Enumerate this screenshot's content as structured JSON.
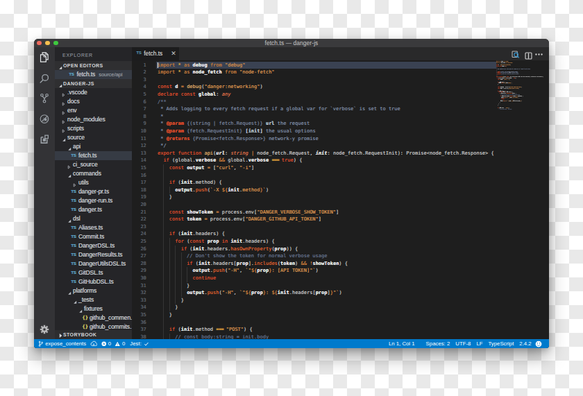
{
  "window": {
    "title": "fetch.ts — danger-js"
  },
  "activity_bar": {
    "icons": [
      "explorer-icon",
      "search-icon",
      "source-control-icon",
      "debug-icon",
      "extensions-icon"
    ],
    "settings_icon": "gear-icon"
  },
  "sidebar": {
    "explorer_title": "EXPLORER",
    "open_editors": {
      "label": "OPEN EDITORS",
      "items": [
        {
          "icon": "TS",
          "name": "fetch.ts",
          "detail": "source/api",
          "selected": true
        }
      ]
    },
    "project": {
      "label": "DANGER-JS",
      "tree": [
        {
          "name": ".vscode",
          "type": "folder",
          "level": 1,
          "expanded": false
        },
        {
          "name": "docs",
          "type": "folder",
          "level": 1,
          "expanded": false
        },
        {
          "name": "env",
          "type": "folder",
          "level": 1,
          "expanded": false
        },
        {
          "name": "node_modules",
          "type": "folder",
          "level": 1,
          "expanded": false
        },
        {
          "name": "scripts",
          "type": "folder",
          "level": 1,
          "expanded": false
        },
        {
          "name": "source",
          "type": "folder",
          "level": 1,
          "expanded": true
        },
        {
          "name": "api",
          "type": "folder",
          "level": 2,
          "expanded": true
        },
        {
          "name": "fetch.ts",
          "type": "ts",
          "level": 3,
          "selected": true
        },
        {
          "name": "ci_source",
          "type": "folder",
          "level": 2,
          "expanded": false
        },
        {
          "name": "commands",
          "type": "folder",
          "level": 2,
          "expanded": true
        },
        {
          "name": "utils",
          "type": "folder",
          "level": 3,
          "expanded": false
        },
        {
          "name": "danger-pr.ts",
          "type": "ts",
          "level": 3
        },
        {
          "name": "danger-run.ts",
          "type": "ts",
          "level": 3
        },
        {
          "name": "danger.ts",
          "type": "ts",
          "level": 3
        },
        {
          "name": "dsl",
          "type": "folder",
          "level": 2,
          "expanded": true
        },
        {
          "name": "Aliases.ts",
          "type": "ts",
          "level": 3
        },
        {
          "name": "Commit.ts",
          "type": "ts",
          "level": 3
        },
        {
          "name": "DangerDSL.ts",
          "type": "ts",
          "level": 3
        },
        {
          "name": "DangerResults.ts",
          "type": "ts",
          "level": 3
        },
        {
          "name": "DangerUtilsDSL.ts",
          "type": "ts",
          "level": 3
        },
        {
          "name": "GitDSL.ts",
          "type": "ts",
          "level": 3
        },
        {
          "name": "GitHubDSL.ts",
          "type": "ts",
          "level": 3
        },
        {
          "name": "platforms",
          "type": "folder",
          "level": 2,
          "expanded": true
        },
        {
          "name": "_tests",
          "type": "folder",
          "level": 3,
          "expanded": true
        },
        {
          "name": "fixtures",
          "type": "folder",
          "level": 4,
          "expanded": true
        },
        {
          "name": "github_commen..",
          "type": "json",
          "level": 5
        },
        {
          "name": "github_commits..",
          "type": "json",
          "level": 5
        }
      ]
    },
    "storybook": {
      "label": "STORYBOOK"
    }
  },
  "editor": {
    "tab": {
      "icon": "TS",
      "label": "fetch.ts",
      "close": "✕"
    },
    "actions": [
      "open-changes-icon",
      "split-editor-icon",
      "more-actions-icon"
    ],
    "lines": [
      {
        "n": 1,
        "tokens": [
          [
            "ik",
            "import "
          ],
          [
            "st",
            "* "
          ],
          [
            "ik",
            "as "
          ],
          [
            "v",
            "debug "
          ],
          [
            "ik",
            "from "
          ],
          [
            "s",
            "\"debug\""
          ]
        ]
      },
      {
        "n": 2,
        "tokens": [
          [
            "ik",
            "import "
          ],
          [
            "st",
            "* "
          ],
          [
            "ik",
            "as "
          ],
          [
            "v",
            "node_fetch "
          ],
          [
            "ik",
            "from "
          ],
          [
            "s",
            "\"node-fetch\""
          ]
        ]
      },
      {
        "n": 3,
        "tokens": []
      },
      {
        "n": 4,
        "tokens": [
          [
            "k",
            "const "
          ],
          [
            "v",
            "d "
          ],
          [
            "op",
            "= "
          ],
          [
            "fd",
            "debug"
          ],
          [
            "p",
            "("
          ],
          [
            "s",
            "\"danger:networking\""
          ],
          [
            "p",
            ")"
          ]
        ]
      },
      {
        "n": 5,
        "tokens": [
          [
            "k",
            "declare "
          ],
          [
            "k",
            "const "
          ],
          [
            "v",
            "global"
          ],
          [
            "p",
            ": "
          ],
          [
            "ty",
            "any"
          ]
        ]
      },
      {
        "n": 6,
        "tokens": [
          [
            "c",
            "/**"
          ]
        ]
      },
      {
        "n": 7,
        "tokens": [
          [
            "dc",
            " * Adds logging to every fetch request if a global var for `verbose` is set to true"
          ]
        ]
      },
      {
        "n": 8,
        "tokens": [
          [
            "dc",
            " *"
          ]
        ]
      },
      {
        "n": 9,
        "tokens": [
          [
            "dc",
            " * "
          ],
          [
            "dt",
            "@param "
          ],
          [
            "db",
            "{(string | fetch.Request)} "
          ],
          [
            "dn",
            "url "
          ],
          [
            "dc",
            "the request"
          ]
        ]
      },
      {
        "n": 10,
        "tokens": [
          [
            "dc",
            " * "
          ],
          [
            "dt",
            "@param "
          ],
          [
            "db",
            "{fetch.RequestInit} "
          ],
          [
            "dn",
            "[init] "
          ],
          [
            "dc",
            "the usual options"
          ]
        ]
      },
      {
        "n": 11,
        "tokens": [
          [
            "dc",
            " * "
          ],
          [
            "dt",
            "@returns "
          ],
          [
            "db",
            "{Promise<fetch.Response>} "
          ],
          [
            "dc",
            "network-y promise"
          ]
        ]
      },
      {
        "n": 12,
        "tokens": [
          [
            "dc",
            " */"
          ]
        ]
      },
      {
        "n": 13,
        "tokens": [
          [
            "k",
            "export "
          ],
          [
            "k",
            "function "
          ],
          [
            "fd",
            "api"
          ],
          [
            "p",
            "("
          ],
          [
            "pi",
            "url"
          ],
          [
            "p",
            ": "
          ],
          [
            "ty",
            "string "
          ],
          [
            "op",
            "| "
          ],
          [
            "p",
            "node_fetch.Request, "
          ],
          [
            "pi",
            "init"
          ],
          [
            "p",
            ": "
          ],
          [
            "p",
            "node_fetch.RequestInit): Promise<node_fetch.Response> {"
          ]
        ]
      },
      {
        "n": 14,
        "tokens": [
          [
            "p",
            "  "
          ],
          [
            "k",
            "if "
          ],
          [
            "p",
            "(global."
          ],
          [
            "v",
            "verbose "
          ],
          [
            "op",
            "&& "
          ],
          [
            "p",
            "global."
          ],
          [
            "v",
            "verbose "
          ],
          [
            "opb",
            "=== "
          ],
          [
            "k",
            "true"
          ],
          [
            "p",
            ") {"
          ]
        ]
      },
      {
        "n": 15,
        "tokens": [
          [
            "p",
            "    "
          ],
          [
            "k",
            "const "
          ],
          [
            "v",
            "output "
          ],
          [
            "op",
            "= "
          ],
          [
            "p",
            "["
          ],
          [
            "s",
            "\"curl\""
          ],
          [
            "p",
            ", "
          ],
          [
            "s",
            "\"-i\""
          ],
          [
            "p",
            "]"
          ]
        ]
      },
      {
        "n": 16,
        "tokens": []
      },
      {
        "n": 17,
        "tokens": [
          [
            "p",
            "    "
          ],
          [
            "k",
            "if "
          ],
          [
            "p",
            "("
          ],
          [
            "v",
            "init"
          ],
          [
            "p",
            ".method) {"
          ]
        ]
      },
      {
        "n": 18,
        "tokens": [
          [
            "p",
            "      "
          ],
          [
            "v",
            "output"
          ],
          [
            "p",
            "."
          ],
          [
            "fn",
            "push"
          ],
          [
            "p",
            "("
          ],
          [
            "s",
            "`-X "
          ],
          [
            "op",
            "${"
          ],
          [
            "v",
            "init"
          ],
          [
            "p",
            "."
          ],
          [
            "s",
            "method"
          ],
          [
            "op",
            "}"
          ],
          [
            "s",
            "`"
          ],
          [
            "p",
            ")"
          ]
        ]
      },
      {
        "n": 19,
        "tokens": [
          [
            "p",
            "    }"
          ]
        ]
      },
      {
        "n": 20,
        "tokens": []
      },
      {
        "n": 21,
        "tokens": [
          [
            "p",
            "    "
          ],
          [
            "k",
            "const "
          ],
          [
            "v",
            "showToken "
          ],
          [
            "op",
            "= "
          ],
          [
            "p",
            "process.env["
          ],
          [
            "s",
            "\"DANGER_VERBOSE_SHOW_TOKEN\""
          ],
          [
            "p",
            "]"
          ]
        ]
      },
      {
        "n": 22,
        "tokens": [
          [
            "p",
            "    "
          ],
          [
            "k",
            "const "
          ],
          [
            "v",
            "token "
          ],
          [
            "op",
            "= "
          ],
          [
            "p",
            "process.env["
          ],
          [
            "s",
            "\"DANGER_GITHUB_API_TOKEN\""
          ],
          [
            "p",
            "]"
          ]
        ]
      },
      {
        "n": 23,
        "tokens": []
      },
      {
        "n": 24,
        "tokens": [
          [
            "p",
            "    "
          ],
          [
            "k",
            "if "
          ],
          [
            "p",
            "("
          ],
          [
            "v",
            "init"
          ],
          [
            "p",
            ".headers) {"
          ]
        ]
      },
      {
        "n": 25,
        "tokens": [
          [
            "p",
            "      "
          ],
          [
            "k",
            "for "
          ],
          [
            "p",
            "("
          ],
          [
            "k",
            "const "
          ],
          [
            "v",
            "prop "
          ],
          [
            "k",
            "in "
          ],
          [
            "v",
            "init"
          ],
          [
            "p",
            ".headers) {"
          ]
        ]
      },
      {
        "n": 26,
        "tokens": [
          [
            "p",
            "        "
          ],
          [
            "k",
            "if "
          ],
          [
            "p",
            "("
          ],
          [
            "v",
            "init"
          ],
          [
            "p",
            ".headers."
          ],
          [
            "fn",
            "hasOwnProperty"
          ],
          [
            "p",
            "("
          ],
          [
            "v",
            "prop"
          ],
          [
            "p",
            ")) {"
          ]
        ]
      },
      {
        "n": 27,
        "tokens": [
          [
            "c",
            "          // Don't show the token for normal verbose usage"
          ]
        ]
      },
      {
        "n": 28,
        "tokens": [
          [
            "p",
            "          "
          ],
          [
            "k",
            "if "
          ],
          [
            "p",
            "("
          ],
          [
            "v",
            "init"
          ],
          [
            "p",
            ".headers["
          ],
          [
            "v",
            "prop"
          ],
          [
            "p",
            "]."
          ],
          [
            "fn",
            "includes"
          ],
          [
            "p",
            "("
          ],
          [
            "v",
            "token"
          ],
          [
            "p",
            ") "
          ],
          [
            "op",
            "&& "
          ],
          [
            "op",
            "!"
          ],
          [
            "v",
            "showToken"
          ],
          [
            "p",
            ") {"
          ]
        ]
      },
      {
        "n": 29,
        "tokens": [
          [
            "p",
            "            "
          ],
          [
            "v",
            "output"
          ],
          [
            "p",
            "."
          ],
          [
            "fn",
            "push"
          ],
          [
            "p",
            "("
          ],
          [
            "s",
            "\"-H\""
          ],
          [
            "p",
            ", "
          ],
          [
            "s",
            "`\""
          ],
          [
            "op",
            "${"
          ],
          [
            "v",
            "prop"
          ],
          [
            "op",
            "}"
          ],
          [
            "s",
            ": [API TOKEN]\"`"
          ],
          [
            "p",
            ")"
          ]
        ]
      },
      {
        "n": 30,
        "tokens": [
          [
            "p",
            "            "
          ],
          [
            "k",
            "continue"
          ]
        ]
      },
      {
        "n": 31,
        "tokens": [
          [
            "p",
            "          }"
          ]
        ]
      },
      {
        "n": 32,
        "tokens": [
          [
            "p",
            "          "
          ],
          [
            "v",
            "output"
          ],
          [
            "p",
            "."
          ],
          [
            "fn",
            "push"
          ],
          [
            "p",
            "("
          ],
          [
            "s",
            "\"-H\""
          ],
          [
            "p",
            ", "
          ],
          [
            "s",
            "`\""
          ],
          [
            "op",
            "${"
          ],
          [
            "v",
            "prop"
          ],
          [
            "op",
            "}"
          ],
          [
            "s",
            ": "
          ],
          [
            "op",
            "${"
          ],
          [
            "v",
            "init"
          ],
          [
            "p",
            ".headers["
          ],
          [
            "v",
            "prop"
          ],
          [
            "p",
            "]"
          ],
          [
            "op",
            "}"
          ],
          [
            "s",
            "\"`"
          ],
          [
            "p",
            ")"
          ]
        ]
      },
      {
        "n": 33,
        "tokens": [
          [
            "p",
            "        }"
          ]
        ]
      },
      {
        "n": 34,
        "tokens": [
          [
            "p",
            "      }"
          ]
        ]
      },
      {
        "n": 35,
        "tokens": [
          [
            "p",
            "    }"
          ]
        ]
      },
      {
        "n": 36,
        "tokens": []
      },
      {
        "n": 37,
        "tokens": [
          [
            "p",
            "    "
          ],
          [
            "k",
            "if "
          ],
          [
            "p",
            "("
          ],
          [
            "v",
            "init"
          ],
          [
            "p",
            ".method "
          ],
          [
            "opb",
            "=== "
          ],
          [
            "s",
            "\"POST\""
          ],
          [
            "p",
            ") {"
          ]
        ]
      },
      {
        "n": 38,
        "tokens": [
          [
            "c",
            "      // const body:string = init.body"
          ]
        ]
      }
    ]
  },
  "status_bar": {
    "left": [
      {
        "icon": "git-branch-icon",
        "label": "expose_contents"
      },
      {
        "icon": "sync-icon",
        "label": ""
      },
      {
        "icon": "error-icon",
        "label": "0"
      },
      {
        "icon": "warning-icon",
        "label": "0"
      },
      {
        "icon": "",
        "label": "Jest:"
      },
      {
        "icon": "check-icon",
        "label": ""
      }
    ],
    "right": [
      "Ln 1, Col 1",
      "Spaces: 2",
      "UTF-8",
      "LF",
      "TypeScript",
      "2.4.2"
    ],
    "feedback_icon": "smiley-icon"
  }
}
